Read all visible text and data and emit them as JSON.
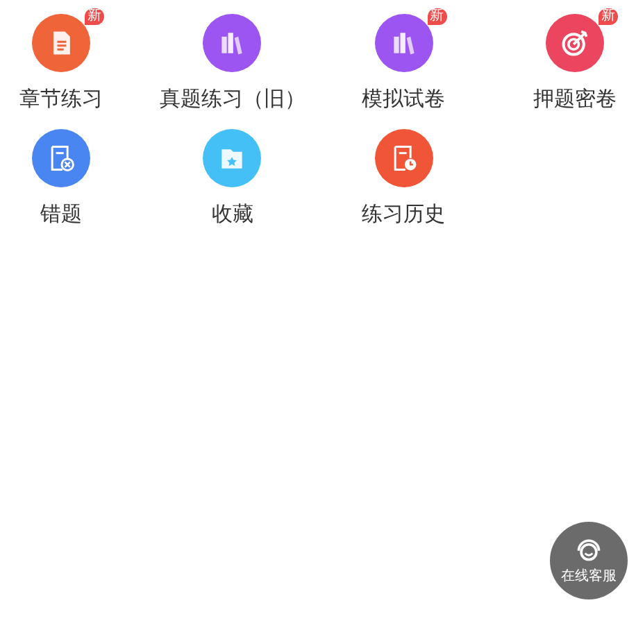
{
  "menu_items": [
    {
      "label": "章节练习",
      "kind": "document",
      "color": "#f0643a",
      "badge": "新"
    },
    {
      "label": "真题练习（旧）",
      "kind": "books",
      "color": "#9d55f2"
    },
    {
      "label": "模拟试卷",
      "kind": "books",
      "color": "#9d55f2",
      "badge": "新"
    },
    {
      "label": "押题密卷",
      "kind": "target",
      "color": "#ec4560",
      "badge": "新"
    },
    {
      "label": "错题",
      "kind": "wrong",
      "color": "#4a86f2"
    },
    {
      "label": "收藏",
      "kind": "folder",
      "color": "#45c0f6"
    },
    {
      "label": "练习历史",
      "kind": "history",
      "color": "#ef5536"
    }
  ],
  "support_button": {
    "label": "在线客服"
  }
}
